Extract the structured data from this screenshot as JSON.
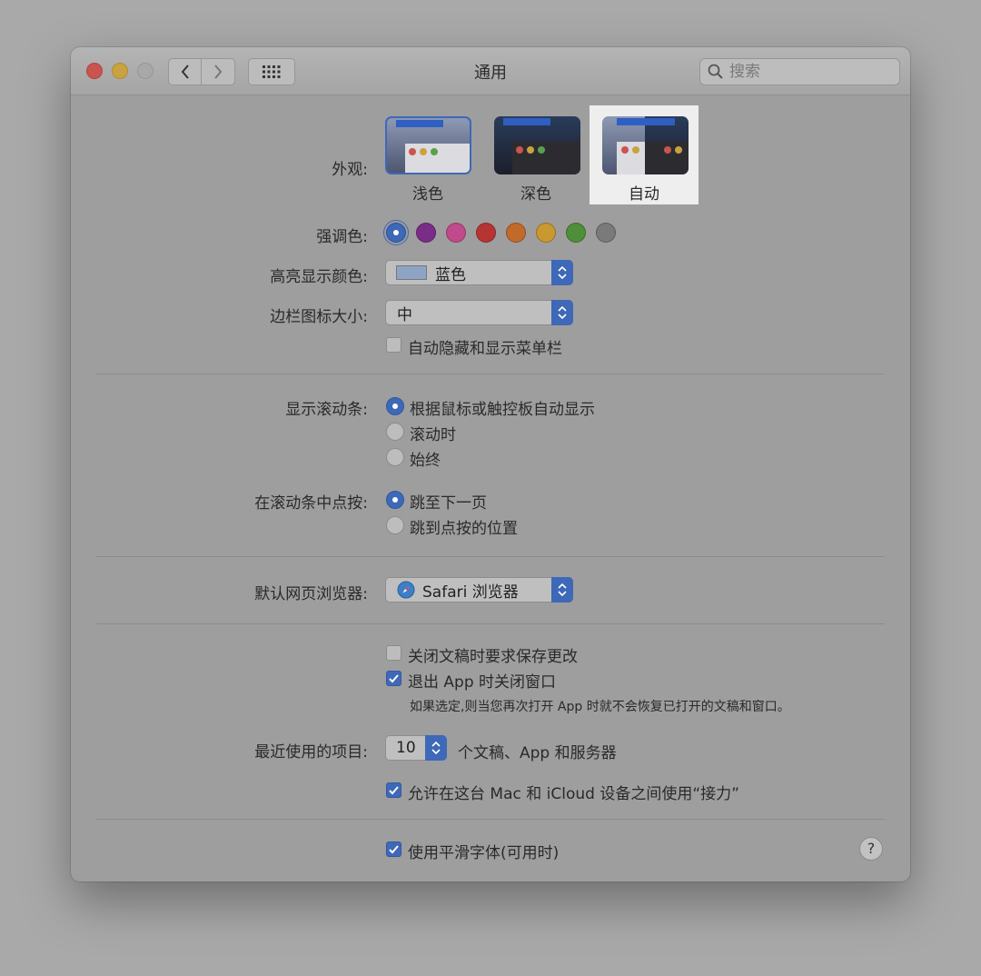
{
  "window": {
    "title": "通用"
  },
  "search": {
    "placeholder": "搜索"
  },
  "appearance": {
    "label": "外观:",
    "options": [
      "浅色",
      "深色",
      "自动"
    ],
    "selected": "浅色"
  },
  "accent": {
    "label": "强调色:",
    "colors": [
      "#3e68b8",
      "#7a2d86",
      "#c04a8c",
      "#b63434",
      "#c16a2a",
      "#c9982f",
      "#4f8f3a",
      "#7a7a7a"
    ],
    "selected_index": 0
  },
  "highlight": {
    "label": "高亮显示颜色:",
    "value": "蓝色",
    "swatch_color": "#8fa3c4"
  },
  "sidebar_icon_size": {
    "label": "边栏图标大小:",
    "value": "中"
  },
  "auto_hide_menu": {
    "label": "自动隐藏和显示菜单栏",
    "checked": false
  },
  "show_scrollbars": {
    "label": "显示滚动条:",
    "options": [
      "根据鼠标或触控板自动显示",
      "滚动时",
      "始终"
    ],
    "selected_index": 0
  },
  "click_scrollbar": {
    "label": "在滚动条中点按:",
    "options": [
      "跳至下一页",
      "跳到点按的位置"
    ],
    "selected_index": 0
  },
  "default_browser": {
    "label": "默认网页浏览器:",
    "value": "Safari 浏览器",
    "icon": "safari-compass-icon"
  },
  "ask_keep_changes": {
    "label": "关闭文稿时要求保存更改",
    "checked": false
  },
  "close_windows": {
    "label": "退出 App 时关闭窗口",
    "checked": true,
    "note": "如果选定,则当您再次打开 App 时就不会恢复已打开的文稿和窗口。"
  },
  "recent_items": {
    "label": "最近使用的项目:",
    "value": "10",
    "suffix": "个文稿、App 和服务器"
  },
  "handoff": {
    "label": "允许在这台 Mac 和 iCloud 设备之间使用“接力”",
    "checked": true
  },
  "font_smoothing": {
    "label": "使用平滑字体(可用时)",
    "checked": true
  },
  "help": {
    "label": "?"
  }
}
